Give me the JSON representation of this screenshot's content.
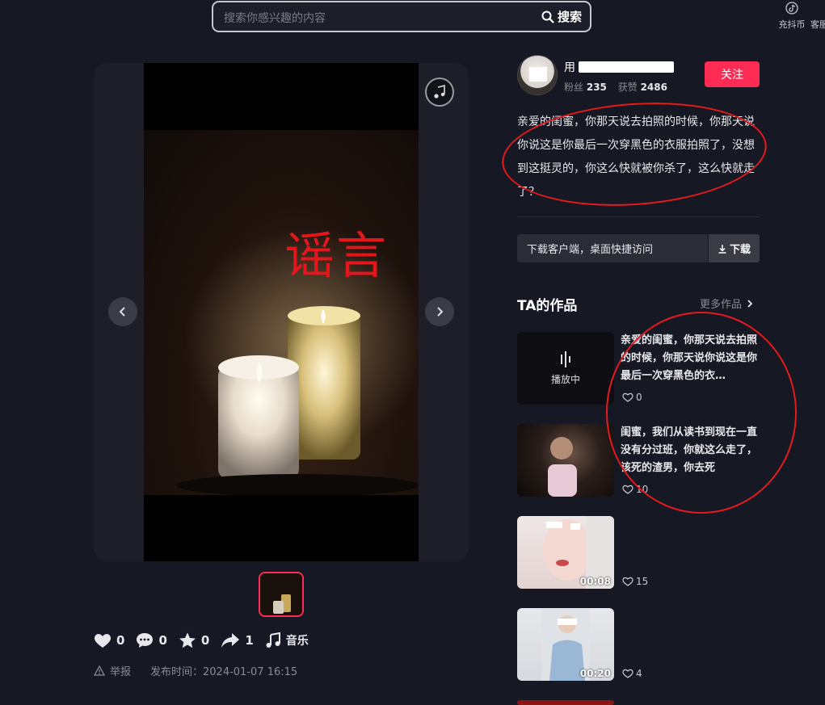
{
  "header": {
    "search_placeholder": "搜索你感兴趣的内容",
    "search_button": "搜索",
    "recharge": "充抖币",
    "service": "客服"
  },
  "video": {
    "overlay_text": "谣言",
    "actions": {
      "likes": "0",
      "comments": "0",
      "favorites": "0",
      "shares": "1",
      "music_label": "音乐"
    },
    "report_label": "举报",
    "publish_time": "发布时间：2024-01-07 16:15"
  },
  "author": {
    "name_prefix": "用",
    "fans_label": "粉丝",
    "fans_count": "235",
    "likes_label": "获赞",
    "likes_count": "2486",
    "follow_label": "关注"
  },
  "description": "亲爱的闺蜜，你那天说去拍照的时候，你那天说你说这是你最后一次穿黑色的衣服拍照了，没想到这挺灵的，你这么快就被你杀了，这么快就走了？",
  "download": {
    "text": "下载客户端，桌面快捷访问",
    "button": "下载"
  },
  "works": {
    "title": "TA的作品",
    "more": "更多作品",
    "playing_label": "播放中",
    "items": [
      {
        "text": "亲爱的闺蜜，你那天说去拍照的时候，你那天说你说这是你最后一次穿黑色的衣…",
        "likes": "0",
        "duration": ""
      },
      {
        "text": "闺蜜，我们从读书到现在一直没有分过班，你就这么走了，该死的渣男，你去死",
        "likes": "10",
        "duration": ""
      },
      {
        "text": "",
        "likes": "15",
        "duration": "00:08"
      },
      {
        "text": "",
        "likes": "4",
        "duration": "00:20"
      }
    ]
  },
  "colors": {
    "background": "#161823",
    "accent": "#fe2c55",
    "annotation": "#e51a1f",
    "overlay_text": "#e3161b"
  }
}
